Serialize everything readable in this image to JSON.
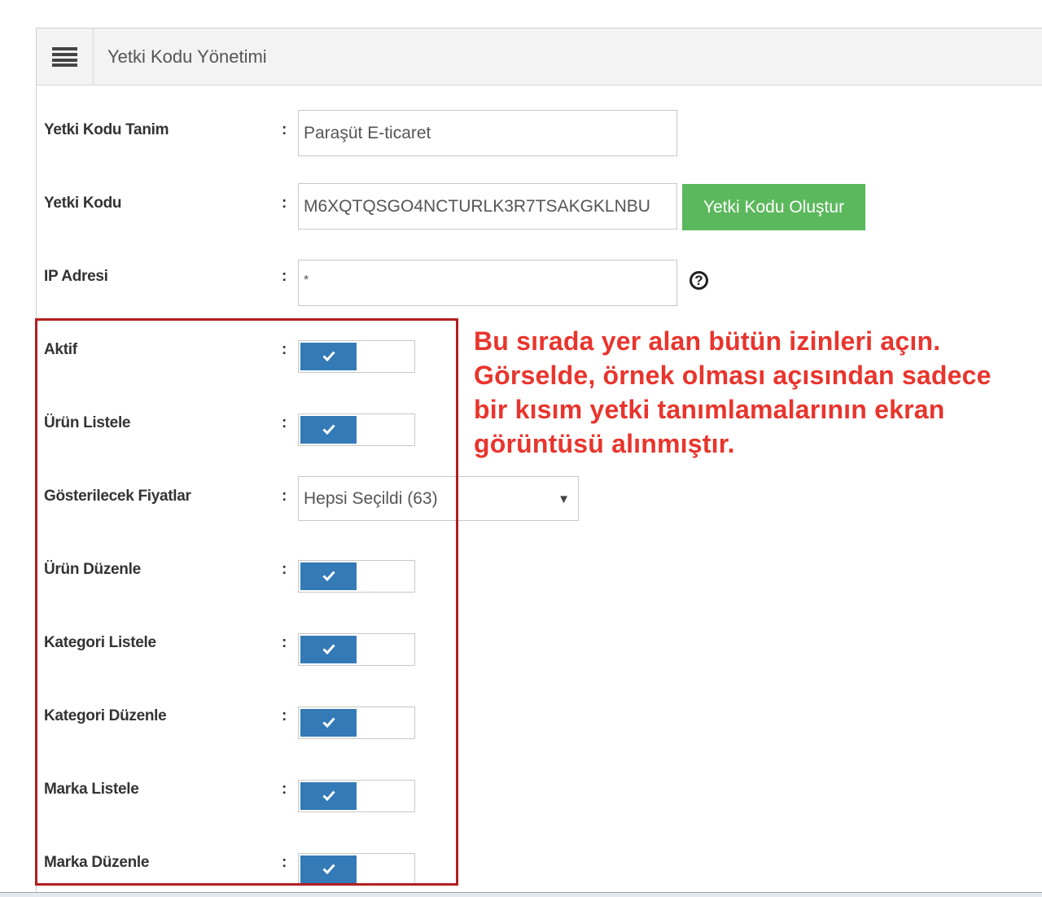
{
  "header": {
    "title": "Yetki Kodu Yönetimi",
    "menu_icon": "hamburger-icon"
  },
  "form": {
    "colon": ":",
    "name_label": "Yetki Kodu Tanim",
    "name_value": "Paraşüt E-ticaret",
    "code_label": "Yetki Kodu",
    "code_value": "M6XQTQSGO4NCTURLK3R7TSAKGKLNBU",
    "generate_button": "Yetki Kodu Oluştur",
    "ip_label": "IP Adresi",
    "ip_value": "*",
    "help_icon": "?"
  },
  "permissions": [
    {
      "label": "Aktif",
      "type": "toggle",
      "checked": true
    },
    {
      "label": "Ürün Listele",
      "type": "toggle",
      "checked": true
    },
    {
      "label": "Gösterilecek Fiyatlar",
      "type": "select",
      "value": "Hepsi Seçildi (63)"
    },
    {
      "label": "Ürün Düzenle",
      "type": "toggle",
      "checked": true
    },
    {
      "label": "Kategori Listele",
      "type": "toggle",
      "checked": true
    },
    {
      "label": "Kategori Düzenle",
      "type": "toggle",
      "checked": true
    },
    {
      "label": "Marka Listele",
      "type": "toggle",
      "checked": true
    },
    {
      "label": "Marka Düzenle",
      "type": "toggle",
      "checked": true
    }
  ],
  "select_arrow": "▼",
  "annotation": {
    "lines": [
      "Bu sırada yer alan bütün izinleri açın.",
      "Görselde, örnek olması açısından sadece",
      "bir kısım yetki tanımlamalarının ekran",
      "görüntüsü alınmıştır."
    ],
    "color": "#e8352d",
    "box_color": "#b21e1e"
  },
  "colors": {
    "toggle_on": "#337ab7",
    "generate_button": "#5cb85c"
  }
}
